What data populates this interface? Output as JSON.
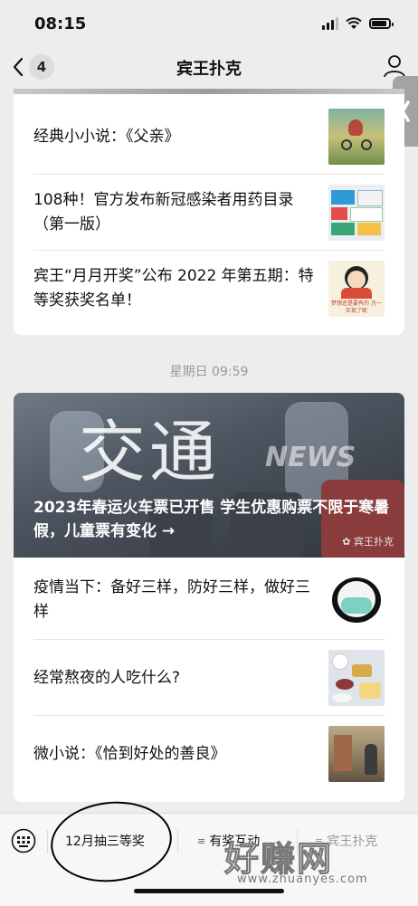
{
  "status": {
    "time": "08:15"
  },
  "nav": {
    "back_count": "4",
    "title": "宾王扑克"
  },
  "top_articles": [
    {
      "title": "经典小小说：《父亲》",
      "thumb": "cyclist-painting-thumbnail"
    },
    {
      "title": "108种！官方发布新冠感染者用药目录（第一版）",
      "thumb": "medicine-boxes-thumbnail"
    },
    {
      "title": "宾王“月月开奖”公布 2022 年第五期：特等奖获奖名单！",
      "thumb": "cartoon-thumbnail"
    }
  ],
  "thumb_text": {
    "cartoon_caption": "梦想还是要有的 万一实现了呢"
  },
  "timestamp": "星期日 09:59",
  "hero": {
    "big_text": "交通",
    "news_text": "NEWS",
    "headline": "2023年春运火车票已开售 学生优惠购票不限于寒暑假，儿童票有变化 →",
    "source": "宾王扑克"
  },
  "main_articles": [
    {
      "title": "疫情当下：备好三样，防好三样，做好三样",
      "thumb": "panda-mask-thumbnail"
    },
    {
      "title": "经常熬夜的人吃什么?",
      "thumb": "food-table-thumbnail"
    },
    {
      "title": "微小说：《恰到好处的善良》",
      "thumb": "street-photo-thumbnail"
    }
  ],
  "bottom_menu": {
    "item1": "12月抽三等奖",
    "item2": "有奖互动",
    "item3": "宾王扑克"
  },
  "watermark": {
    "main": "好赚网",
    "sub": "www.zhuanyes.com"
  },
  "colors": {
    "background": "#ededed",
    "card": "#ffffff",
    "timestamp": "#9a9a9a"
  }
}
